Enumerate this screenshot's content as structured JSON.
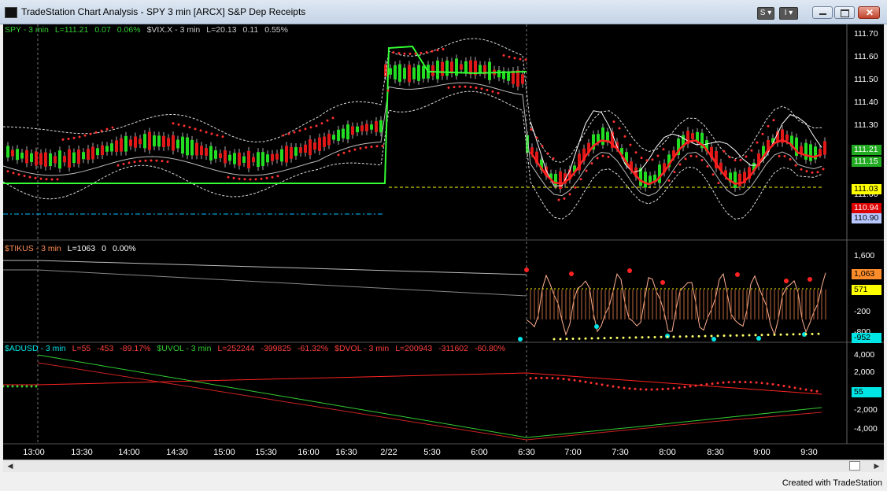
{
  "window": {
    "title": "TradeStation Chart Analysis - SPY 3 min [ARCX] S&P Dep Receipts",
    "style_button_label": "S",
    "extra_button_label": "I"
  },
  "legends": {
    "price": [
      {
        "text": "SPY - 3 min",
        "color": "#33cc33"
      },
      {
        "text": "L=111.21",
        "color": "#33cc33"
      },
      {
        "text": "0.07",
        "color": "#33cc33"
      },
      {
        "text": "0.06%",
        "color": "#33cc33"
      },
      {
        "text": "$VIX.X - 3 min",
        "color": "#c8c8c8"
      },
      {
        "text": "L=20.13",
        "color": "#c8c8c8"
      },
      {
        "text": "0.11",
        "color": "#c8c8c8"
      },
      {
        "text": "0.55%",
        "color": "#c8c8c8"
      }
    ],
    "tick": [
      {
        "text": "$TIKUS - 3 min",
        "color": "#ff8c55"
      },
      {
        "text": "L=1063",
        "color": "#ffffff"
      },
      {
        "text": "0",
        "color": "#ffffff"
      },
      {
        "text": "0.00%",
        "color": "#ffffff"
      }
    ],
    "breadth": [
      {
        "text": "$ADUSD - 3 min",
        "color": "#00e5e5"
      },
      {
        "text": "L=55",
        "color": "#ff4040"
      },
      {
        "text": "-453",
        "color": "#ff4040"
      },
      {
        "text": "-89.17%",
        "color": "#ff4040"
      },
      {
        "text": "$UVOL - 3 min",
        "color": "#33cc33"
      },
      {
        "text": "L=252244",
        "color": "#ff4040"
      },
      {
        "text": "-399825",
        "color": "#ff4040"
      },
      {
        "text": "-61.32%",
        "color": "#ff4040"
      },
      {
        "text": "$DVOL - 3 min",
        "color": "#ff4040"
      },
      {
        "text": "L=200943",
        "color": "#ff4040"
      },
      {
        "text": "-311602",
        "color": "#ff4040"
      },
      {
        "text": "-60.80%",
        "color": "#ff4040"
      }
    ]
  },
  "price_axis": [
    "111.70",
    "111.60",
    "111.50",
    "111.40",
    "111.30",
    "111.00",
    "110.90"
  ],
  "price_badges": [
    {
      "text": "111.21",
      "bg": "#22aa22",
      "fg": "#ffffff"
    },
    {
      "text": "111.15",
      "bg": "#22aa22",
      "fg": "#ffffff"
    },
    {
      "text": "111.03",
      "bg": "#ffff00",
      "fg": "#000000"
    },
    {
      "text": "110.94",
      "bg": "#dd0000",
      "fg": "#ffffff"
    },
    {
      "text": "110.90",
      "bg": "#b8c8ff",
      "fg": "#000000"
    }
  ],
  "tick_axis": [
    "1,600",
    "-200",
    "-800"
  ],
  "tick_badges": [
    {
      "text": "1,063",
      "bg": "#ff8c2a",
      "fg": "#000000"
    },
    {
      "text": "571",
      "bg": "#ffff00",
      "fg": "#000000"
    },
    {
      "text": "-952",
      "bg": "#00e5e5",
      "fg": "#000000"
    }
  ],
  "breadth_axis": [
    "4,000",
    "2,000",
    "-2,000",
    "-4,000"
  ],
  "breadth_badges": [
    {
      "text": "55",
      "bg": "#00e5e5",
      "fg": "#000000"
    }
  ],
  "time_axis": [
    "13:00",
    "13:30",
    "14:00",
    "14:30",
    "15:00",
    "15:30",
    "16:00",
    "16:30",
    "2/22",
    "5:30",
    "6:00",
    "6:30",
    "7:00",
    "7:30",
    "8:00",
    "8:30",
    "9:00",
    "9:30"
  ],
  "footer": "Created with TradeStation"
}
